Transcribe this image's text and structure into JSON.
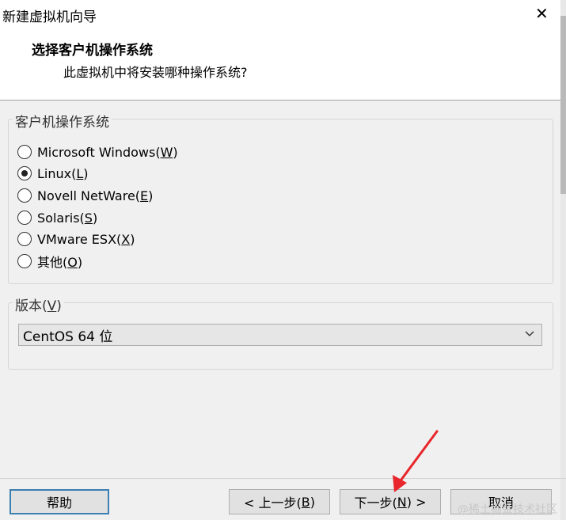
{
  "window": {
    "title": "新建虚拟机向导",
    "close_glyph": "✕"
  },
  "header": {
    "heading": "选择客户机操作系统",
    "subheading": "此虚拟机中将安装哪种操作系统?"
  },
  "guest_os_group": {
    "legend": "客户机操作系统",
    "options": [
      {
        "text": "Microsoft Windows(",
        "key": "W",
        "tail": ")",
        "selected": false
      },
      {
        "text": "Linux(",
        "key": "L",
        "tail": ")",
        "selected": true
      },
      {
        "text": "Novell NetWare(",
        "key": "E",
        "tail": ")",
        "selected": false
      },
      {
        "text": "Solaris(",
        "key": "S",
        "tail": ")",
        "selected": false
      },
      {
        "text": "VMware ESX(",
        "key": "X",
        "tail": ")",
        "selected": false
      },
      {
        "text": "其他(",
        "key": "O",
        "tail": ")",
        "selected": false
      }
    ]
  },
  "version_group": {
    "legend_prefix": "版本(",
    "legend_key": "V",
    "legend_tail": ")",
    "selected_value": "CentOS 64 位"
  },
  "buttons": {
    "help": "帮助",
    "back_prefix": "< 上一步(",
    "back_key": "B",
    "back_tail": ")",
    "next_prefix": "下一步(",
    "next_key": "N",
    "next_tail": ") >",
    "cancel": "取消"
  },
  "annotation": {
    "arrow_color": "#e8262b"
  },
  "watermark": "@稀土掘金技术社区"
}
